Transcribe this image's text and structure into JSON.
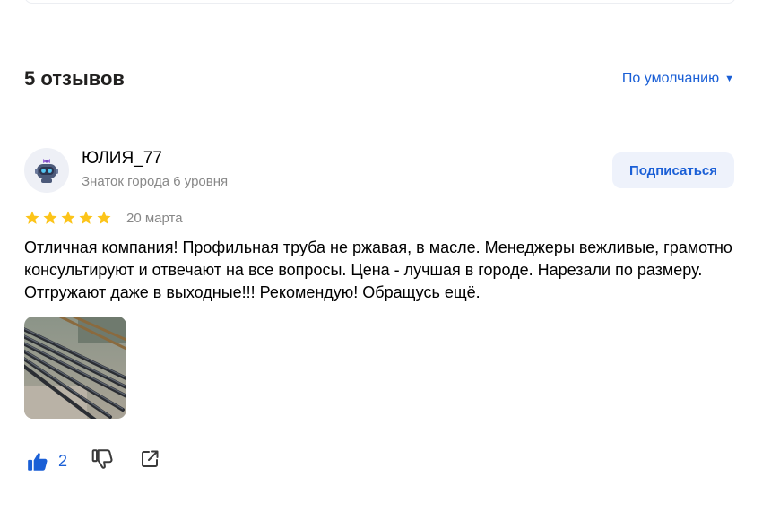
{
  "reviews_header": {
    "title": "5 отзывов",
    "sort_label": "По умолчанию",
    "sort_caret": "▼"
  },
  "review": {
    "author": {
      "name": "ЮЛИЯ_77",
      "level": "Знаток города 6 уровня",
      "avatar_icon": "robot-avatar-icon"
    },
    "subscribe_label": "Подписаться",
    "rating": 5,
    "date": "20 марта",
    "text": "Отличная компания! Профильная труба не ржавая, в масле. Менеджеры вежливые, грамотно консультируют и отвечают на все вопросы. Цена - лучшая в городе. Нарезали по размеру. Отгружают даже в выходные!!! Рекомендую! Обращусь ещё.",
    "photo_icon": "steel-pipes-photo",
    "likes": "2",
    "actions": [
      "thumbs-up-icon",
      "thumbs-down-icon",
      "share-icon"
    ]
  },
  "colors": {
    "accent": "#1a5fd6",
    "star": "#fcc419",
    "muted_text": "#888888",
    "subscribe_bg": "#eef2fb",
    "divider": "#e8e8e8"
  }
}
